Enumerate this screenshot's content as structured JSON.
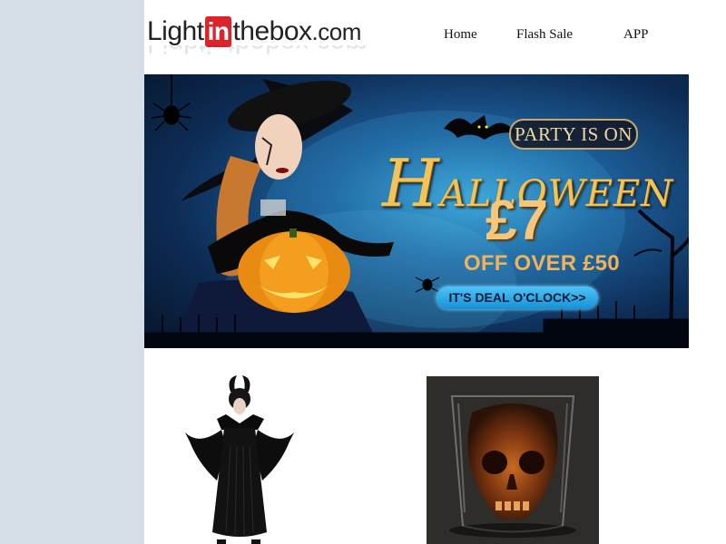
{
  "header": {
    "logo_light": "Light",
    "logo_in": "in",
    "logo_thebox": "thebox",
    "logo_dotcom": ".com",
    "nav": [
      "Home",
      "Flash Sale",
      "APP"
    ]
  },
  "banner": {
    "badge": "PARTY IS ON",
    "headline_first": "H",
    "headline_rest": "ALLOWEEN",
    "price": "£7",
    "subline": "OFF OVER £50",
    "cta": "IT'S DEAL O'CLOCK>>"
  },
  "products": [
    {
      "icon": "witch-costume-image"
    },
    {
      "icon": "skull-shot-glass-image"
    }
  ],
  "colors": {
    "background": "#d5dde6",
    "brand_red": "#d9252b",
    "banner_gold": "#f2c458",
    "cta_blue": "#1591d6"
  }
}
